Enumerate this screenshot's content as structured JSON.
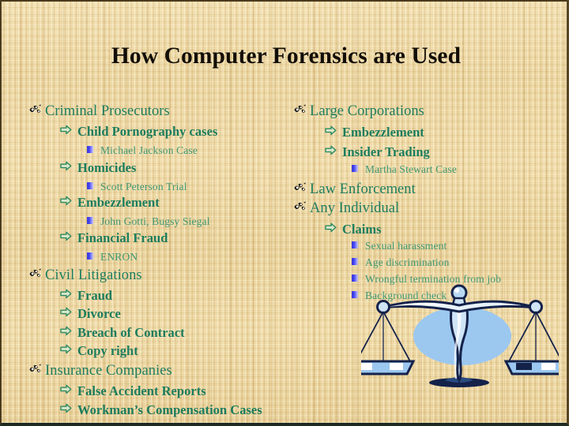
{
  "slide": {
    "title": "How Computer Forensics are Used",
    "background": "#e9d09a",
    "title_color": "#120d06",
    "level1_color": "#1d7d5f",
    "level2_color": "#1c7c5d",
    "level3_color": "#3f9874",
    "bullet_square_color": "#3c3ce0",
    "clipart_accent": "#9cc8f0",
    "clipart_outline": "#1c2f5c"
  },
  "icons": {
    "level1": "scribble-bullet-icon",
    "level2": "right-arrow-bullet-icon",
    "level3": "blue-square-bullet-icon",
    "clipart": "scales-of-justice-icon"
  },
  "left_column": [
    {
      "level": 1,
      "text": "Criminal Prosecutors"
    },
    {
      "level": 2,
      "text": "Child Pornography cases"
    },
    {
      "level": 3,
      "text": "Michael Jackson Case"
    },
    {
      "level": 2,
      "text": "Homicides"
    },
    {
      "level": 3,
      "text": "Scott Peterson Trial"
    },
    {
      "level": 2,
      "text": "Embezzlement"
    },
    {
      "level": 3,
      "text": "John Gotti, Bugsy Siegal"
    },
    {
      "level": 2,
      "text": "Financial Fraud"
    },
    {
      "level": 3,
      "text": "ENRON"
    },
    {
      "level": 1,
      "text": "Civil Litigations"
    },
    {
      "level": 2,
      "text": "Fraud"
    },
    {
      "level": 2,
      "text": "Divorce"
    },
    {
      "level": 2,
      "text": "Breach of Contract"
    },
    {
      "level": 2,
      "text": "Copy right"
    },
    {
      "level": 1,
      "text": "Insurance Companies"
    },
    {
      "level": 2,
      "text": "False Accident Reports"
    },
    {
      "level": 2,
      "text": "Workman’s Compensation Cases"
    }
  ],
  "right_column": [
    {
      "level": 1,
      "text": "Large Corporations"
    },
    {
      "level": 2,
      "text": "Embezzlement"
    },
    {
      "level": 2,
      "text": "Insider Trading"
    },
    {
      "level": 3,
      "text": "Martha Stewart Case"
    },
    {
      "level": 1,
      "text": "Law Enforcement"
    },
    {
      "level": 1,
      "text": "Any Individual"
    },
    {
      "level": 2,
      "text": "Claims"
    },
    {
      "level": 3,
      "text": "Sexual harassment"
    },
    {
      "level": 3,
      "text": "Age discrimination"
    },
    {
      "level": 3,
      "text": "Wrongful termination from job"
    },
    {
      "level": 3,
      "text": "Background check"
    }
  ]
}
